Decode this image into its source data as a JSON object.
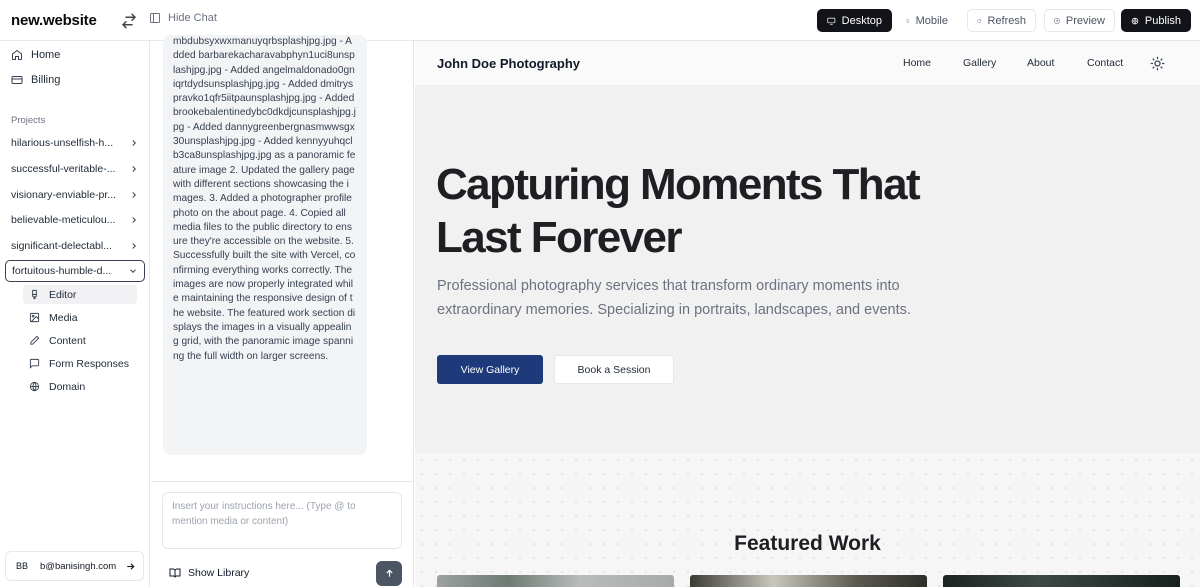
{
  "topbar": {
    "brand": "new.website",
    "hide_chat": "Hide Chat",
    "desktop": "Desktop",
    "mobile": "Mobile",
    "refresh": "Refresh",
    "preview": "Preview",
    "publish": "Publish"
  },
  "sidebar": {
    "nav": [
      {
        "label": "Home",
        "icon": "home-icon"
      },
      {
        "label": "Billing",
        "icon": "credit-card-icon"
      }
    ],
    "projects_label": "Projects",
    "projects": [
      "hilarious-unselfish-h...",
      "successful-veritable-...",
      "visionary-enviable-pr...",
      "believable-meticulou...",
      "significant-delectabl...",
      "fortuitous-humble-d..."
    ],
    "sub_items": [
      {
        "label": "Editor",
        "icon": "brush-icon"
      },
      {
        "label": "Media",
        "icon": "image-icon"
      },
      {
        "label": "Content",
        "icon": "pencil-icon"
      },
      {
        "label": "Form Responses",
        "icon": "message-square-icon"
      },
      {
        "label": "Domain",
        "icon": "globe-icon"
      }
    ],
    "user": {
      "initials": "BB",
      "email": "b@banisingh.com"
    }
  },
  "chat": {
    "message": "mbdubsyxwxmanuyqrbsplashjpg.jpg - Added barbarekacharavabphyn1uci8unsplashjpg.jpg - Added angelmaldonado0gniqrtdydsunsplashjpg.jpg - Added dmitryspravko1qfr5iitpaunsplashjpg.jpg - Added brookebalentinedybc0dkdjcunsplashjpg.jpg - Added dannygreenbergnasmwwsgx30unsplashjpg.jpg - Added kennyyuhqclb3ca8unsplashjpg.jpg as a panoramic feature image 2. Updated the gallery page with different sections showcasing the images. 3. Added a photographer profile photo on the about page. 4. Copied all media files to the public directory to ensure they're accessible on the website. 5. Successfully built the site with Vercel, confirming everything works correctly. The images are now properly integrated while maintaining the responsive design of the website. The featured work section displays the images in a visually appealing grid, with the panoramic image spanning the full width on larger screens.",
    "input_placeholder": "Insert your instructions here... (Type @ to mention media or content)",
    "show_library": "Show Library"
  },
  "preview": {
    "site_name": "John Doe Photography",
    "nav": [
      "Home",
      "Gallery",
      "About",
      "Contact"
    ],
    "hero_title": "Capturing Moments That Last Forever",
    "hero_subtitle": "Professional photography services that transform ordinary moments into extraordinary memories. Specializing in portraits, landscapes, and events.",
    "primary_cta": "View Gallery",
    "secondary_cta": "Book a Session",
    "featured_title": "Featured Work"
  },
  "colors": {
    "primary_button": "#1e3a7b",
    "dark_button": "#111319",
    "hero_bg": "#f1f1f2"
  }
}
